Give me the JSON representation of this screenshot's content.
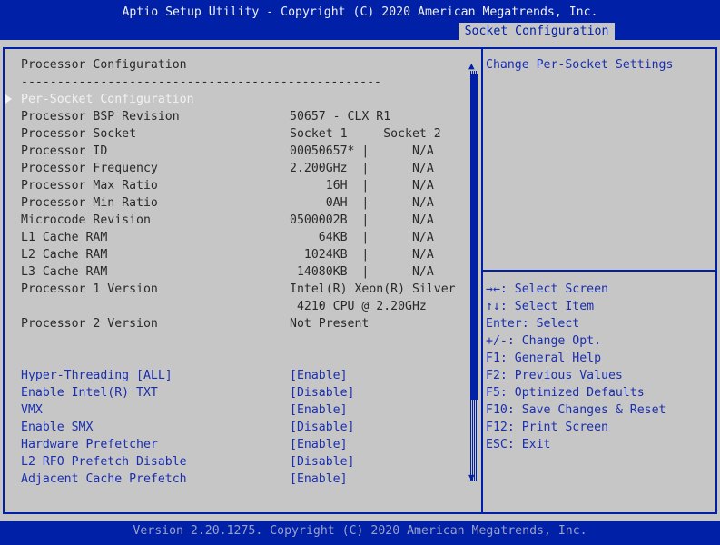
{
  "header": {
    "title": "Aptio Setup Utility - Copyright (C) 2020 American Megatrends, Inc.",
    "active_tab": "Socket Configuration"
  },
  "section_title": "Processor Configuration",
  "separator": "--------------------------------------------------",
  "submenu": "Per-Socket Configuration",
  "info_rows": [
    {
      "label": "Processor BSP Revision",
      "value": "50657 - CLX R1"
    },
    {
      "label": "Processor Socket",
      "value": "Socket 1     Socket 2"
    },
    {
      "label": "Processor ID",
      "value": "00050657* |      N/A"
    },
    {
      "label": "Processor Frequency",
      "value": "2.200GHz  |      N/A"
    },
    {
      "label": "Processor Max Ratio",
      "value": "     16H  |      N/A"
    },
    {
      "label": "Processor Min Ratio",
      "value": "     0AH  |      N/A"
    },
    {
      "label": "Microcode Revision",
      "value": "0500002B  |      N/A"
    },
    {
      "label": "L1 Cache RAM",
      "value": "    64KB  |      N/A"
    },
    {
      "label": "L2 Cache RAM",
      "value": "  1024KB  |      N/A"
    },
    {
      "label": "L3 Cache RAM",
      "value": " 14080KB  |      N/A"
    },
    {
      "label": "Processor 1 Version",
      "value": "Intel(R) Xeon(R) Silver"
    },
    {
      "label": "",
      "value": " 4210 CPU @ 2.20GHz"
    },
    {
      "label": "Processor 2 Version",
      "value": "Not Present"
    }
  ],
  "options": [
    {
      "label": "Hyper-Threading [ALL]",
      "value": "[Enable]"
    },
    {
      "label": "Enable Intel(R) TXT",
      "value": "[Disable]"
    },
    {
      "label": "VMX",
      "value": "[Enable]"
    },
    {
      "label": "Enable SMX",
      "value": "[Disable]"
    },
    {
      "label": "Hardware Prefetcher",
      "value": "[Enable]"
    },
    {
      "label": "L2 RFO Prefetch Disable",
      "value": "[Disable]"
    },
    {
      "label": "Adjacent Cache Prefetch",
      "value": "[Enable]"
    }
  ],
  "help_text": "Change Per-Socket Settings",
  "key_help": [
    "→←: Select Screen",
    "↑↓: Select Item",
    "Enter: Select",
    "+/-: Change Opt.",
    "F1: General Help",
    "F2: Previous Values",
    "F5: Optimized Defaults",
    "F10: Save Changes & Reset",
    "F12: Print Screen",
    "ESC: Exit"
  ],
  "scroll_up": "▲",
  "scroll_down": "▼",
  "footer": "Version 2.20.1275. Copyright (C) 2020 American Megatrends, Inc.",
  "colors": {
    "frame_blue": "#0020a8",
    "background": "#c6c6c6",
    "option_blue": "#1a2fb0"
  }
}
